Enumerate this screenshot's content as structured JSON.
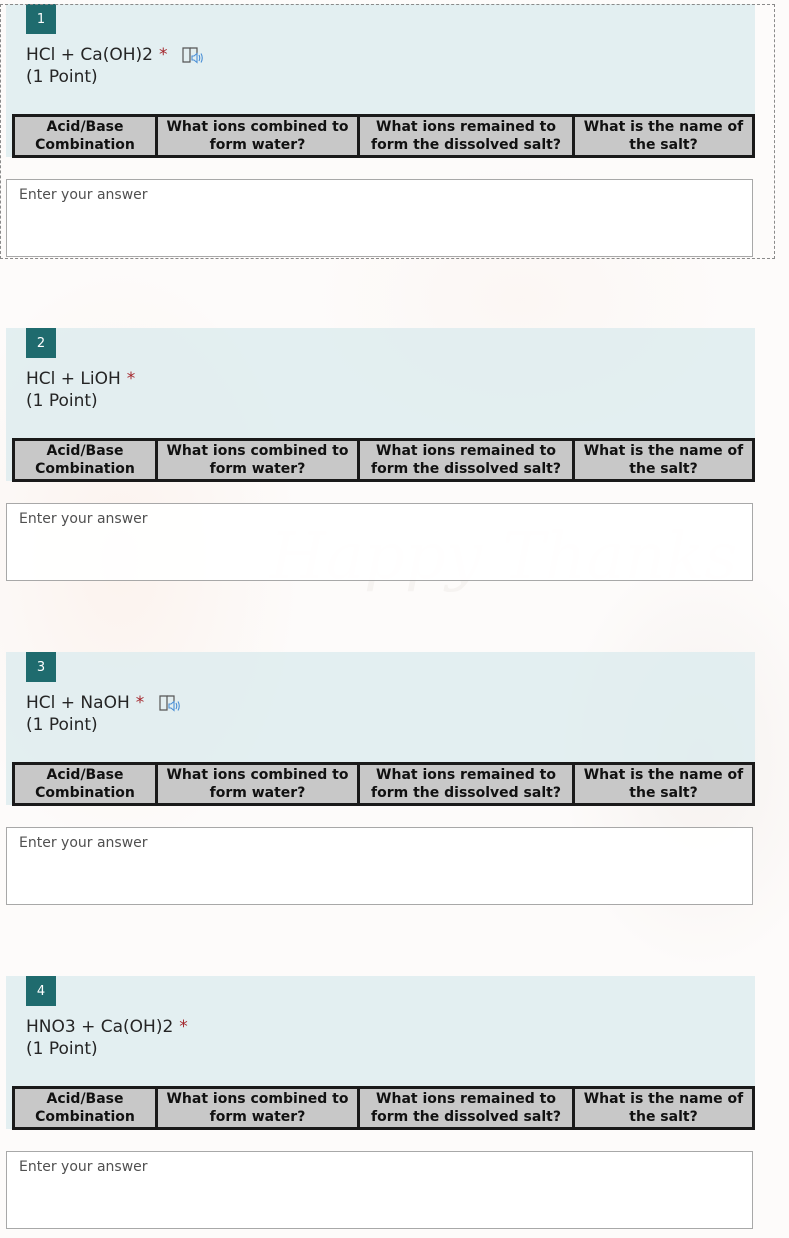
{
  "background": {
    "watermark_text": "Happy Thanks"
  },
  "colors": {
    "badge": "#1f6b6e",
    "required": "#a4262c",
    "header_bg": "#deecee",
    "table_header_bg": "#c8c8c8"
  },
  "table_headers": [
    "Acid/Base Combination",
    "What ions combined to form water?",
    "What ions remained to form the dissolved salt?",
    "What is the name of the salt?"
  ],
  "questions": [
    {
      "number": "1",
      "title": "HCl + Ca(OH)2",
      "required_mark": "*",
      "points": "(1 Point)",
      "has_reader_icon": true,
      "answer_placeholder": "Enter your answer",
      "answer_value": ""
    },
    {
      "number": "2",
      "title": "HCl + LiOH",
      "required_mark": "*",
      "points": "(1 Point)",
      "has_reader_icon": false,
      "answer_placeholder": "Enter your answer",
      "answer_value": ""
    },
    {
      "number": "3",
      "title": "HCl + NaOH",
      "required_mark": "*",
      "points": "(1 Point)",
      "has_reader_icon": true,
      "answer_placeholder": "Enter your answer",
      "answer_value": ""
    },
    {
      "number": "4",
      "title": "HNO3 + Ca(OH)2",
      "required_mark": "*",
      "points": "(1 Point)",
      "has_reader_icon": false,
      "answer_placeholder": "Enter your answer",
      "answer_value": ""
    }
  ]
}
